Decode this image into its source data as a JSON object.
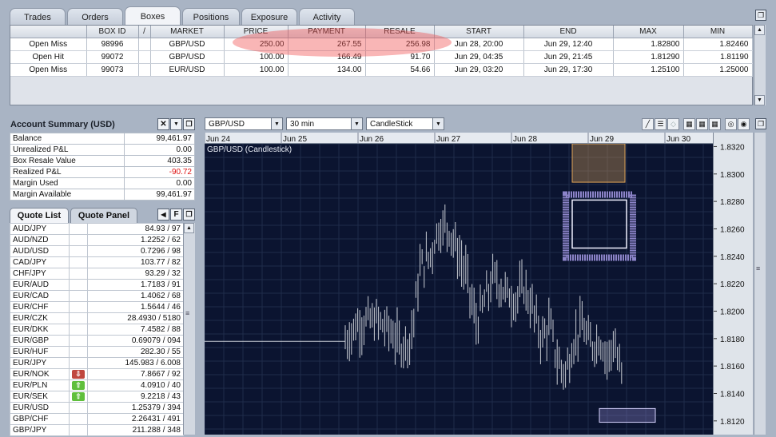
{
  "tabs": [
    "Trades",
    "Orders",
    "Boxes",
    "Positions",
    "Exposure",
    "Activity"
  ],
  "active_tab": "Boxes",
  "boxes": {
    "columns": [
      "",
      "BOX ID",
      "/",
      "MARKET",
      "PRICE",
      "PAYMENT",
      "RESALE",
      "START",
      "END",
      "MAX",
      "MIN"
    ],
    "rows": [
      [
        "Open Miss",
        "98996",
        "",
        "GBP/USD",
        "250.00",
        "267.55",
        "256.98",
        "Jun 28, 20:00",
        "Jun 29, 12:40",
        "1.82800",
        "1.82460"
      ],
      [
        "Open Hit",
        "99072",
        "",
        "GBP/USD",
        "100.00",
        "166.49",
        "91.70",
        "Jun 29, 04:35",
        "Jun 29, 21:45",
        "1.81290",
        "1.81190"
      ],
      [
        "Open Miss",
        "99073",
        "",
        "EUR/USD",
        "100.00",
        "134.00",
        "54.66",
        "Jun 29, 03:20",
        "Jun 29, 17:30",
        "1.25100",
        "1.25000"
      ]
    ]
  },
  "account": {
    "title": "Account Summary (USD)",
    "rows": [
      {
        "label": "Balance",
        "value": "99,461.97"
      },
      {
        "label": "Unrealized P&L",
        "value": "0.00"
      },
      {
        "label": "Box Resale Value",
        "value": "403.35"
      },
      {
        "label": "Realized P&L",
        "value": "-90.72"
      },
      {
        "label": "Margin Used",
        "value": "0.00"
      },
      {
        "label": "Margin Available",
        "value": "99,461.97"
      }
    ]
  },
  "quote_tabs": [
    "Quote List",
    "Quote Panel"
  ],
  "quote_panel_btn": "F",
  "quotes": [
    {
      "pair": "AUD/JPY",
      "arrow": "",
      "quote": "84.93 / 97"
    },
    {
      "pair": "AUD/NZD",
      "arrow": "",
      "quote": "1.2252 / 62"
    },
    {
      "pair": "AUD/USD",
      "arrow": "",
      "quote": "0.7296 / 98"
    },
    {
      "pair": "CAD/JPY",
      "arrow": "",
      "quote": "103.77 / 82"
    },
    {
      "pair": "CHF/JPY",
      "arrow": "",
      "quote": "93.29 / 32"
    },
    {
      "pair": "EUR/AUD",
      "arrow": "",
      "quote": "1.7183 / 91"
    },
    {
      "pair": "EUR/CAD",
      "arrow": "",
      "quote": "1.4062 / 68"
    },
    {
      "pair": "EUR/CHF",
      "arrow": "",
      "quote": "1.5644 / 46"
    },
    {
      "pair": "EUR/CZK",
      "arrow": "",
      "quote": "28.4930 / 5180"
    },
    {
      "pair": "EUR/DKK",
      "arrow": "",
      "quote": "7.4582 / 88"
    },
    {
      "pair": "EUR/GBP",
      "arrow": "",
      "quote": "0.69079 / 094"
    },
    {
      "pair": "EUR/HUF",
      "arrow": "",
      "quote": "282.30 / 55"
    },
    {
      "pair": "EUR/JPY",
      "arrow": "",
      "quote": "145.983 / 6.008"
    },
    {
      "pair": "EUR/NOK",
      "arrow": "down",
      "quote": "7.8667 / 92"
    },
    {
      "pair": "EUR/PLN",
      "arrow": "up",
      "quote": "4.0910 / 40"
    },
    {
      "pair": "EUR/SEK",
      "arrow": "up",
      "quote": "9.2218 / 43"
    },
    {
      "pair": "EUR/USD",
      "arrow": "",
      "quote": "1.25379 / 394"
    },
    {
      "pair": "GBP/CHF",
      "arrow": "",
      "quote": "2.26431 / 491"
    },
    {
      "pair": "GBP/JPY",
      "arrow": "",
      "quote": "211.288 / 348"
    }
  ],
  "chart_toolbar": {
    "market": "GBP/USD",
    "interval": "30 min",
    "style": "CandleStick"
  },
  "chart_data": {
    "type": "line",
    "title": "GBP/USD (Candlestick)",
    "x_ticks": [
      "Jun 24",
      "Jun 25",
      "Jun 26",
      "Jun 27",
      "Jun 28",
      "Jun 29",
      "Jun 30"
    ],
    "y_ticks": [
      "1.8320",
      "1.8300",
      "1.8280",
      "1.8260",
      "1.8240",
      "1.8220",
      "1.8200",
      "1.8180",
      "1.8160",
      "1.8140",
      "1.8120"
    ],
    "ylim": [
      1.811,
      1.8322
    ],
    "grid": true,
    "colors": {
      "background": "#0b1430",
      "grid": "#1f2c4a",
      "candle": "#c8ccd4",
      "box_orange": "#e0a558",
      "box_purple": "#8c84c9"
    },
    "note_flat_start": 1.8178
  }
}
